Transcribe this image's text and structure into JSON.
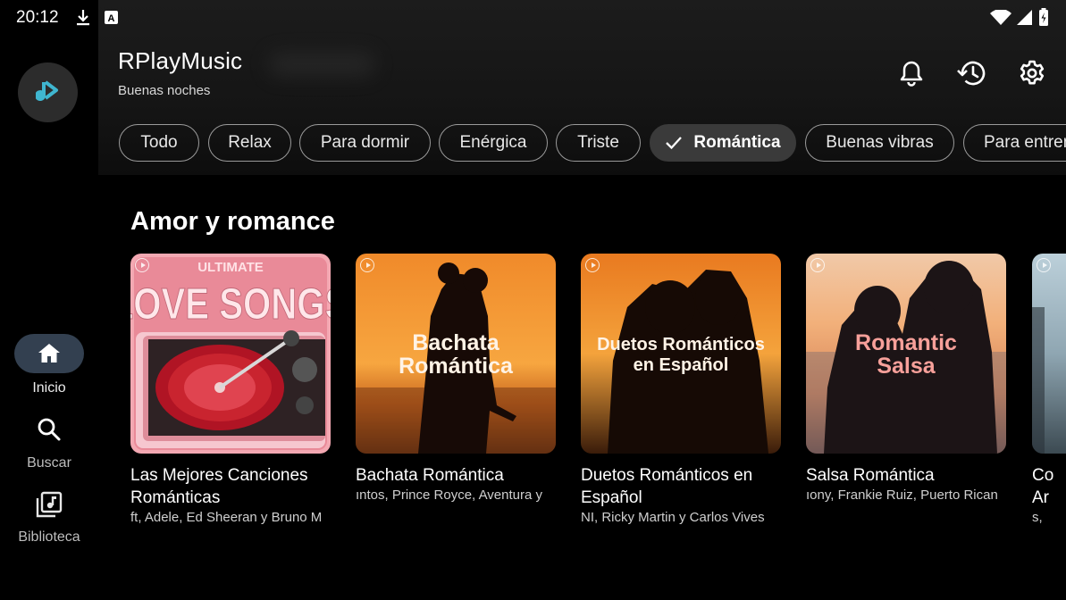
{
  "status_bar": {
    "time": "20:12",
    "icons": [
      "download-icon",
      "a-notification-icon",
      "wifi-icon",
      "signal-icon",
      "battery-icon"
    ]
  },
  "header": {
    "app_name": "RPlayMusic",
    "greeting": "Buenas noches",
    "actions": [
      "notifications-icon",
      "history-icon",
      "settings-icon"
    ]
  },
  "chips": [
    {
      "label": "Todo",
      "selected": false
    },
    {
      "label": "Relax",
      "selected": false
    },
    {
      "label": "Para dormir",
      "selected": false
    },
    {
      "label": "Enérgica",
      "selected": false
    },
    {
      "label": "Triste",
      "selected": false
    },
    {
      "label": "Romántica",
      "selected": true
    },
    {
      "label": "Buenas vibras",
      "selected": false
    },
    {
      "label": "Para entrenar",
      "selected": false
    }
  ],
  "section": {
    "title": "Amor y romance",
    "cards": [
      {
        "title": "Las Mejores Canciones Románticas",
        "title_line1": "Las Mejores Canciones",
        "title_line2": "Románticas",
        "artists": "ft, Adele, Ed Sheeran y Bruno M",
        "cover_text_1": "ULTIMATE",
        "cover_text_2": "LOVE SONGS"
      },
      {
        "title": "Bachata Romántica",
        "title_line1": "Bachata Romántica",
        "title_line2": "",
        "artists": "ıntos, Prince Royce, Aventura y",
        "cover_text_1": "Bachata",
        "cover_text_2": "Romántica"
      },
      {
        "title": "Duetos Románticos en Español",
        "title_line1": "Duetos Románticos en",
        "title_line2": "Español",
        "artists": "NI, Ricky Martin y Carlos Vives",
        "cover_text_1": "Duetos Románticos",
        "cover_text_2": "en Español"
      },
      {
        "title": "Salsa Romántica",
        "title_line1": "Salsa Romántica",
        "title_line2": "",
        "artists": "ıony, Frankie Ruiz, Puerto Rican",
        "cover_text_1": "Romantic",
        "cover_text_2": "Salsa"
      },
      {
        "title": "Co Ar",
        "title_line1": "Co",
        "title_line2": "Ar",
        "artists": "s,",
        "cover_text_1": "",
        "cover_text_2": ""
      }
    ]
  },
  "nav": {
    "items": [
      {
        "label": "Inicio",
        "icon": "home-icon",
        "active": true
      },
      {
        "label": "Buscar",
        "icon": "search-icon",
        "active": false
      },
      {
        "label": "Biblioteca",
        "icon": "library-icon",
        "active": false
      }
    ]
  },
  "colors": {
    "background": "#000000",
    "selected_chip": "#3a3a3a",
    "nav_active": "#334050",
    "logo_accent": "#3fb6d0"
  }
}
